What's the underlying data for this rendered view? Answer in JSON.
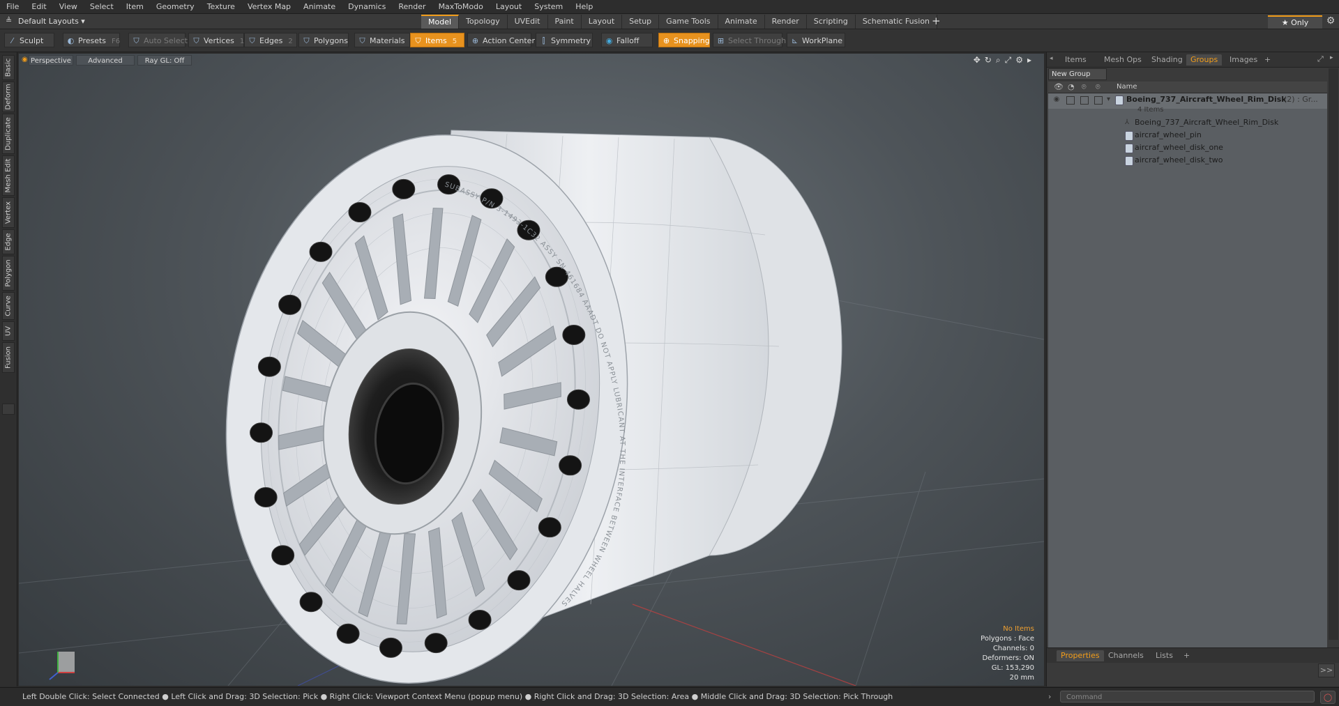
{
  "menu": [
    "File",
    "Edit",
    "View",
    "Select",
    "Item",
    "Geometry",
    "Texture",
    "Vertex Map",
    "Animate",
    "Dynamics",
    "Render",
    "MaxToModo",
    "Layout",
    "System",
    "Help"
  ],
  "layouts_label": "Default Layouts ▾",
  "mode_tabs": [
    "Model",
    "Topology",
    "UVEdit",
    "Paint",
    "Layout",
    "Setup",
    "Game Tools",
    "Animate",
    "Render",
    "Scripting",
    "Schematic Fusion"
  ],
  "mode_add": "+",
  "only_label": "★ Only",
  "settings_glyph": "⚙",
  "toolbar": {
    "sculpt": "Sculpt",
    "presets": "Presets",
    "presets_key": "F6",
    "auto_select": "Auto Select",
    "vertices": "Vertices",
    "vertices_count": "1",
    "edges": "Edges",
    "edges_count": "2",
    "polygons": "Polygons",
    "materials": "Materials",
    "items": "Items",
    "items_count": "5",
    "action_center": "Action Center",
    "symmetry": "Symmetry",
    "falloff": "Falloff",
    "snapping": "Snapping",
    "select_through": "Select Through",
    "workplane": "WorkPlane"
  },
  "left_tabs": [
    "Basic",
    "Deform",
    "Duplicate",
    "Mesh Edit",
    "Vertex",
    "Edge",
    "Polygon",
    "Curve",
    "UV",
    "Fusion"
  ],
  "viewport": {
    "view_mode": "Perspective",
    "shading": "Advanced",
    "raygl": "Ray GL: Off",
    "rim_text": "SUBASSY P/N  3-1493-1C32   ASSY SN 461684   AAADT   DO NOT APPLY LUBRICANT AT THE INTERFACE BETWEEN WHEEL HALVES",
    "info": {
      "no_items": "No Items",
      "polygons": "Polygons : Face",
      "channels": "Channels: 0",
      "deformers": "Deformers: ON",
      "gl": "GL: 153,290",
      "size": "20 mm"
    }
  },
  "right_panel": {
    "tabs": [
      "Items",
      "Mesh Ops",
      "Shading",
      "Groups",
      "Images"
    ],
    "tab_add": "+",
    "new_group": "New Group",
    "name_header": "Name",
    "group": {
      "name": "Boeing_737_Aircraft_Wheel_Rim_Disk",
      "suffix": "(2) : Gr...",
      "count": "4 Items"
    },
    "children": [
      "Boeing_737_Aircraft_Wheel_Rim_Disk",
      "aircraf_wheel_pin",
      "aircraf_wheel_disk_one",
      "aircraf_wheel_disk_two"
    ],
    "bottom_tabs": [
      "Properties",
      "Channels",
      "Lists"
    ],
    "bottom_add": "+",
    "more": ">>"
  },
  "status": {
    "hint": "Left Double Click: Select Connected ● Left Click and Drag: 3D Selection: Pick ● Right Click: Viewport Context Menu (popup menu) ● Right Click and Drag: 3D Selection: Area ● Middle Click and Drag: 3D Selection: Pick Through",
    "command_placeholder": "Command"
  },
  "colors": {
    "accent": "#f29d1a",
    "wheel": "#e9ecf0",
    "lug": "#151515"
  }
}
